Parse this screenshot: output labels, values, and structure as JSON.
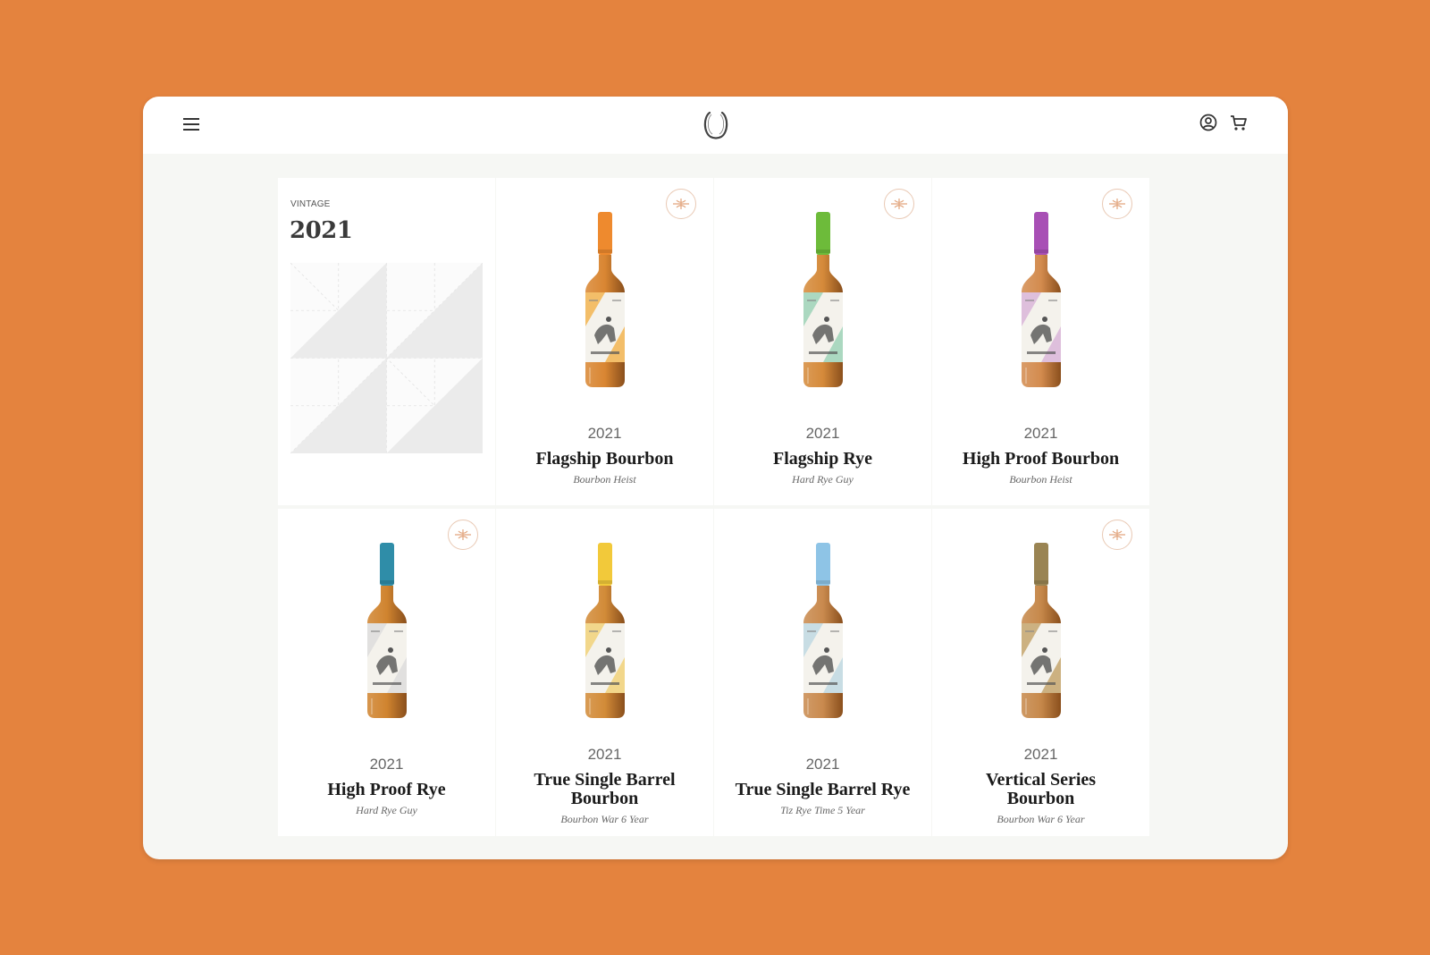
{
  "header": {
    "menu_icon": "hamburger-menu-icon",
    "logo_icon": "horseshoe-logo-icon",
    "account_icon": "user-circle-icon",
    "cart_icon": "shopping-cart-icon"
  },
  "intro": {
    "eyebrow": "VINTAGE",
    "year": "2021"
  },
  "colors": {
    "background": "#E4833E",
    "window": "#F6F7F4",
    "badge_border": "#E9C9B4"
  },
  "products": [
    {
      "year": "2021",
      "name": "Flagship Bourbon",
      "subtitle": "Bourbon Heist",
      "cap_color": "#EE8A2E",
      "liquid_color": "#D98632",
      "label_accent": "#F2B552",
      "badge": true
    },
    {
      "year": "2021",
      "name": "Flagship Rye",
      "subtitle": "Hard Rye Guy",
      "cap_color": "#6DBB3A",
      "liquid_color": "#D58A3A",
      "label_accent": "#9ED3B8",
      "badge": true
    },
    {
      "year": "2021",
      "name": "High Proof Bourbon",
      "subtitle": "Bourbon Heist",
      "cap_color": "#A84FB5",
      "liquid_color": "#D38B4E",
      "label_accent": "#D9B6D9",
      "badge": true
    },
    {
      "year": "2021",
      "name": "High Proof Rye",
      "subtitle": "Hard Rye Guy",
      "cap_color": "#2F8DA8",
      "liquid_color": "#D0842F",
      "label_accent": "#DDDDDD",
      "badge": true
    },
    {
      "year": "2021",
      "name": "True Single Barrel Bourbon",
      "subtitle": "Bourbon War 6 Year",
      "cap_color": "#F2C93A",
      "liquid_color": "#D28B38",
      "label_accent": "#F1D27A",
      "badge": false
    },
    {
      "year": "2021",
      "name": "True Single Barrel Rye",
      "subtitle": "Tiz Rye Time 5 Year",
      "cap_color": "#8EC4E6",
      "liquid_color": "#C98A4E",
      "label_accent": "#BFD9E3",
      "badge": false
    },
    {
      "year": "2021",
      "name": "Vertical Series Bourbon",
      "subtitle": "Bourbon War 6 Year",
      "cap_color": "#9A8453",
      "liquid_color": "#C6884A",
      "label_accent": "#C4A66E",
      "badge": true
    }
  ]
}
